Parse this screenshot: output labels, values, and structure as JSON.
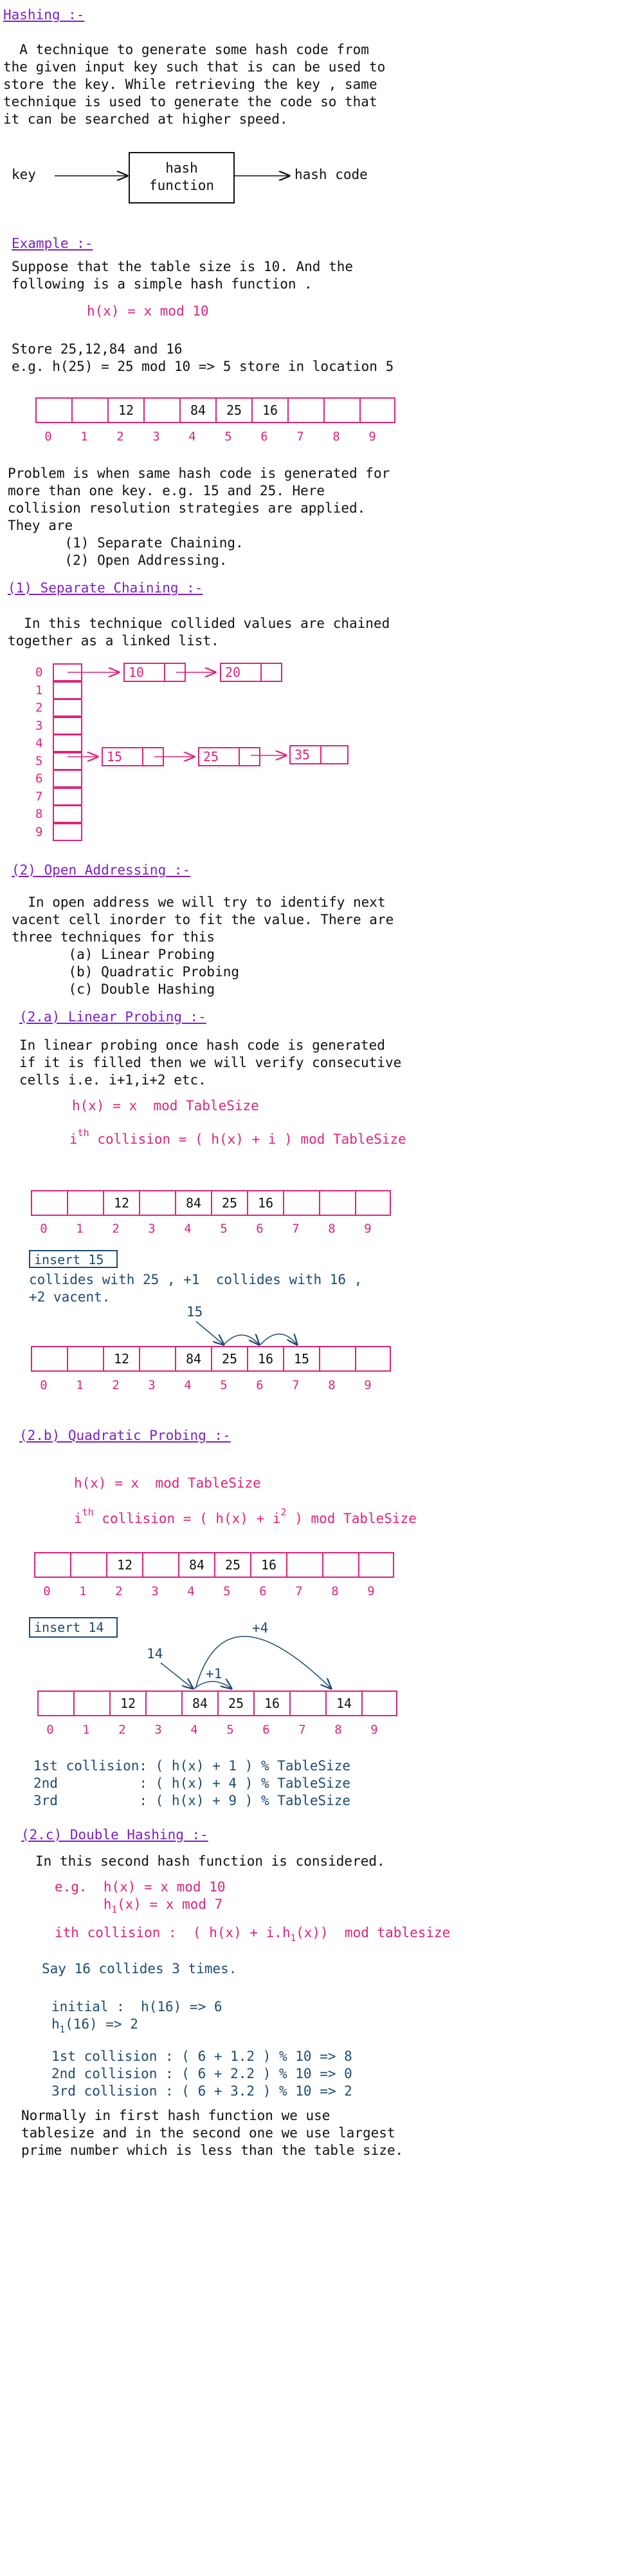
{
  "title": "Hashing :-",
  "intro": [
    "  A technique to generate some hash code from",
    "the given input key such that is can be used to",
    "store the key. While retrieving the key , same",
    "technique is used to generate the code so that",
    "it can be searched at higher speed."
  ],
  "flow": {
    "key": "key",
    "fn_line1": "hash",
    "fn_line2": "function",
    "out": "hash code"
  },
  "example": {
    "heading": "Example :-",
    "lines": [
      "Suppose that the table size is 10. And the",
      "following is a simple hash function ."
    ],
    "func": "h(x) = x mod 10",
    "store1": "Store 25,12,84 and 16",
    "store2": "e.g. h(25) = 25 mod 10 => 5 store in location 5"
  },
  "table": {
    "cells": [
      "",
      "",
      "12",
      "",
      "84",
      "25",
      "16",
      "",
      "",
      ""
    ],
    "indices": [
      "0",
      "1",
      "2",
      "3",
      "4",
      "5",
      "6",
      "7",
      "8",
      "9"
    ]
  },
  "problem": [
    "Problem is when same hash code is generated for",
    "more than one key. e.g. 15 and 25. Here",
    "collision resolution strategies are applied.",
    "They are",
    "       (1) Separate Chaining.",
    "       (2) Open Addressing."
  ],
  "chaining": {
    "heading": "(1) Separate Chaining :-",
    "lines": [
      "  In this technique collided values are chained",
      "together as a linked list."
    ],
    "slots": [
      "0",
      "1",
      "2",
      "3",
      "4",
      "5",
      "6",
      "7",
      "8",
      "9"
    ],
    "row0": [
      "10",
      "20"
    ],
    "row5": [
      "15",
      "25",
      "35"
    ]
  },
  "open": {
    "heading": "(2) Open Addressing :-",
    "lines": [
      "  In open address we will try to identify next",
      "vacent cell inorder to fit the value. There are",
      "three techniques for this",
      "       (a) Linear Probing",
      "       (b) Quadratic Probing",
      "       (c) Double Hashing"
    ]
  },
  "linear": {
    "heading": "(2.a) Linear Probing :-",
    "lines": [
      "In linear probing once hash code is generated",
      "if it is filled then we will verify consecutive",
      "cells i.e. i+1,i+2 etc."
    ],
    "f1": "h(x) = x  mod TableSize",
    "f2_pre": "i",
    "f2_sup": "th",
    "f2_post": " collision = ( h(x) + i ) mod TableSize",
    "cells_before": [
      "",
      "",
      "12",
      "",
      "84",
      "25",
      "16",
      "",
      "",
      ""
    ],
    "insert": "insert 15",
    "note1": "collides with 25 , +1  collides with 16 ,",
    "note2": "+2 vacent.",
    "arrow_label": "15",
    "cells_after": [
      "",
      "",
      "12",
      "",
      "84",
      "25",
      "16",
      "15",
      "",
      ""
    ]
  },
  "quadratic": {
    "heading": "(2.b) Quadratic Probing :-",
    "f1": "h(x) = x  mod TableSize",
    "f2_pre": "i",
    "f2_sup": "th",
    "f2_mid": " collision = ( h(x) + i",
    "f2_sq": "2",
    "f2_post": " ) mod TableSize",
    "cells_before": [
      "",
      "",
      "12",
      "",
      "84",
      "25",
      "16",
      "",
      "",
      ""
    ],
    "insert": "insert 14",
    "label_14": "14",
    "label_p4": "+4",
    "label_p1": "+1",
    "cells_after": [
      "",
      "",
      "12",
      "",
      "84",
      "25",
      "16",
      "",
      "14",
      ""
    ],
    "coll": [
      "1st collision: ( h(x) + 1 ) % TableSize",
      "2nd          : ( h(x) + 4 ) % TableSize",
      "3rd          : ( h(x) + 9 ) % TableSize"
    ]
  },
  "double": {
    "heading": "(2.c) Double Hashing :-",
    "intro": "In this second hash function is considered.",
    "eg1": "e.g.  h(x) = x mod 10",
    "eg2_pre": "      h",
    "eg2_sub": "1",
    "eg2_post": "(x) = x mod 7",
    "ith_pre": "ith collision :  ( h(x) + i.h",
    "ith_sub": "1",
    "ith_post": "(x))  mod tablesize",
    "say": "Say 16 collides 3 times.",
    "init1": "initial :  h(16) => 6",
    "init2_pre": "h",
    "init2_sub": "1",
    "init2_post": "(16) => 2",
    "calc": [
      "1st collision : ( 6 + 1.2 ) % 10 => 8",
      "2nd collision : ( 6 + 2.2 ) % 10 => 0",
      "3rd collision : ( 6 + 3.2 ) % 10 => 2"
    ],
    "final": [
      "Normally in first hash function we use",
      "tablesize and in the second one we use largest",
      "prime number which is less than the table size."
    ]
  }
}
